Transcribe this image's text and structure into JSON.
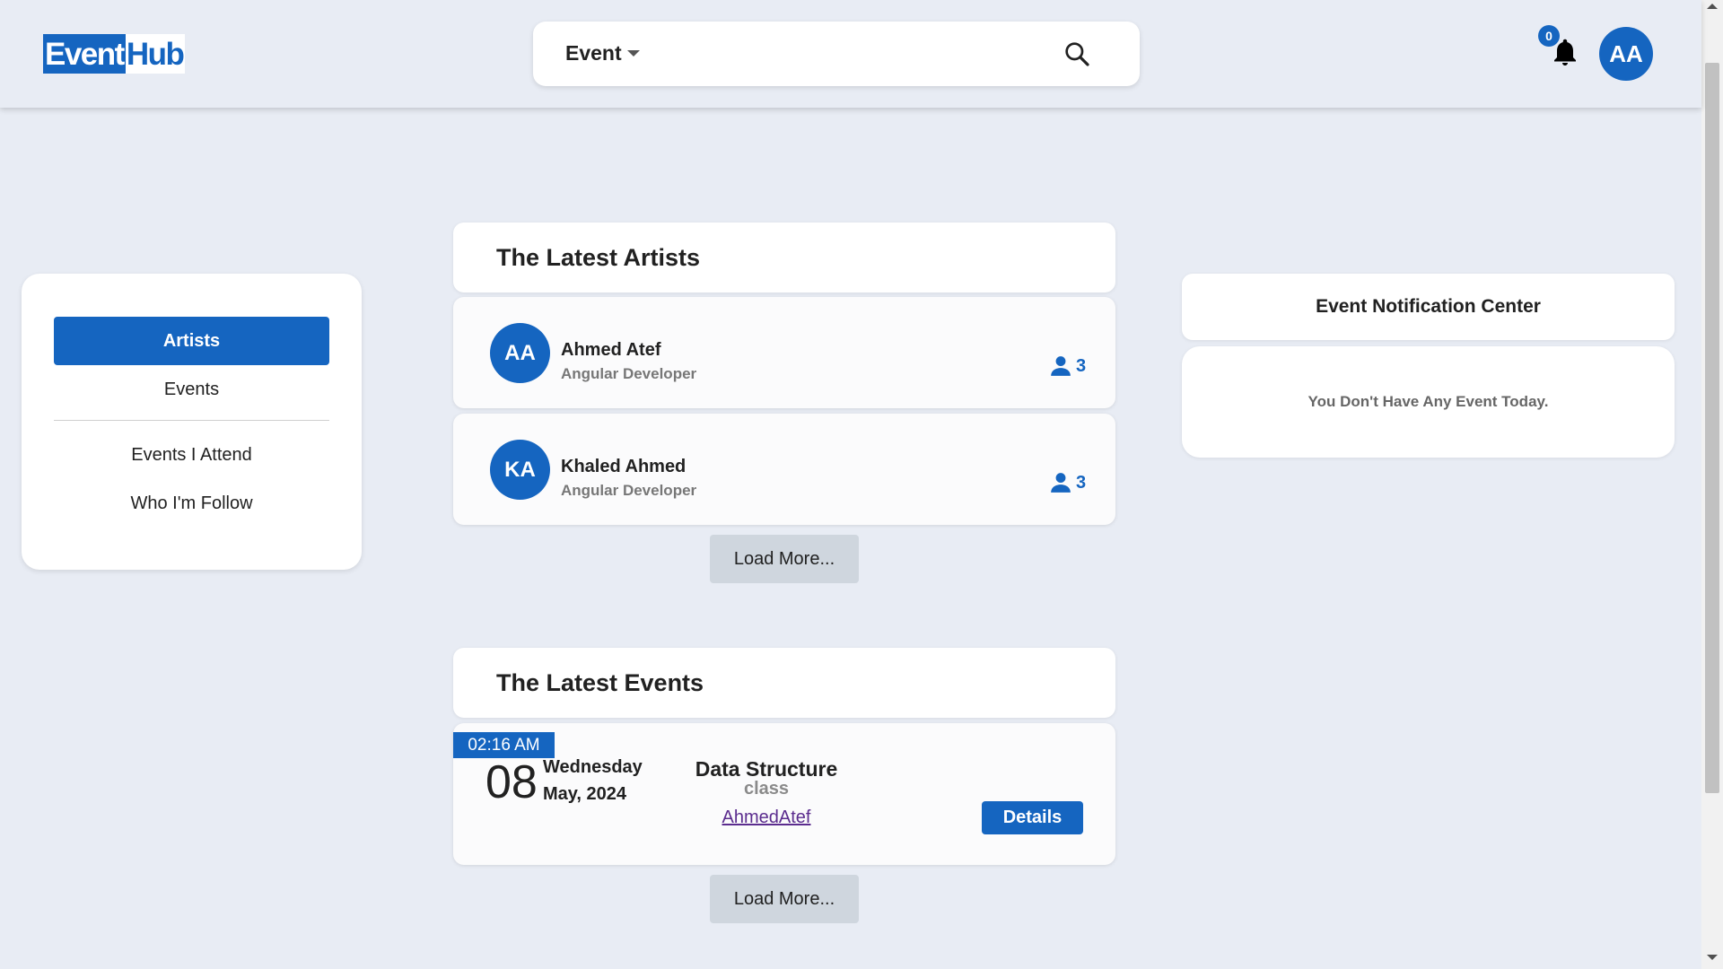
{
  "header": {
    "logo_part1": "Event",
    "logo_part2": "Hub",
    "search_type": "Event",
    "notification_count": "0",
    "user_initials": "AA",
    "icons": {
      "search": "search-icon",
      "bell": "bell-icon",
      "caret": "caret-down-icon"
    }
  },
  "sidebar": {
    "items": [
      {
        "label": "Artists",
        "active": true
      },
      {
        "label": "Events",
        "active": false
      },
      {
        "label": "Events I Attend",
        "active": false
      },
      {
        "label": "Who I'm Follow",
        "active": false
      }
    ]
  },
  "artists": {
    "title": "The Latest Artists",
    "list": [
      {
        "initials": "AA",
        "name": "Ahmed Atef",
        "role": "Angular Developer",
        "followers": "3"
      },
      {
        "initials": "KA",
        "name": "Khaled Ahmed",
        "role": "Angular Developer",
        "followers": "3"
      }
    ],
    "load_more": "Load More..."
  },
  "events": {
    "title": "The Latest Events",
    "list": [
      {
        "time": "02:16 AM",
        "day": "08",
        "weekday": "Wednesday",
        "month_year": "May, 2024",
        "name": "Data Structure",
        "type": "class",
        "author": "AhmedAtef",
        "details_label": "Details"
      }
    ],
    "load_more": "Load More..."
  },
  "notifications": {
    "title": "Event Notification Center",
    "empty_message": "You Don't Have Any Event Today."
  },
  "colors": {
    "primary": "#1565c0",
    "background": "#e8ecf4",
    "link": "#5b2c8e"
  }
}
